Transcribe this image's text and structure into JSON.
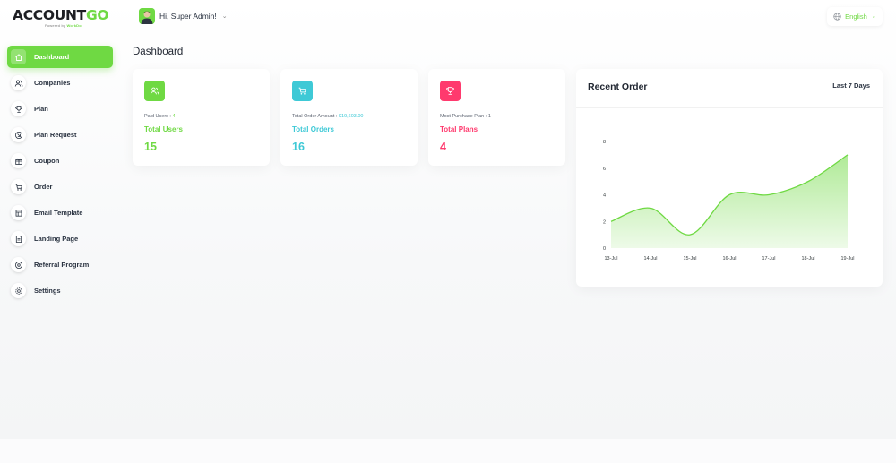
{
  "header": {
    "logo_main": "ACCOUNT",
    "logo_accent": "GO",
    "logo_tagline_prefix": "Powered by",
    "logo_tagline_brand": "WorkDo",
    "greeting": "Hi, Super Admin!",
    "language": "English"
  },
  "sidebar": {
    "items": [
      {
        "label": "Dashboard",
        "icon": "home-icon",
        "active": true
      },
      {
        "label": "Companies",
        "icon": "users-icon",
        "active": false
      },
      {
        "label": "Plan",
        "icon": "trophy-icon",
        "active": false
      },
      {
        "label": "Plan Request",
        "icon": "arrow-circle-icon",
        "active": false
      },
      {
        "label": "Coupon",
        "icon": "gift-icon",
        "active": false
      },
      {
        "label": "Order",
        "icon": "cart-icon",
        "active": false
      },
      {
        "label": "Email Template",
        "icon": "template-icon",
        "active": false
      },
      {
        "label": "Landing Page",
        "icon": "page-icon",
        "active": false
      },
      {
        "label": "Referral Program",
        "icon": "share-icon",
        "active": false
      },
      {
        "label": "Settings",
        "icon": "gear-icon",
        "active": false
      }
    ]
  },
  "page": {
    "title": "Dashboard"
  },
  "stats": [
    {
      "sub_label": "Paid Users : ",
      "sub_value": "4",
      "name": "Total Users",
      "value": "15",
      "color": "#6fd943",
      "icon": "users-icon"
    },
    {
      "sub_label": "Total Order Amount : ",
      "sub_value": "$19,603.00",
      "name": "Total Orders",
      "value": "16",
      "color": "#3ec9d6",
      "icon": "cart-icon"
    },
    {
      "sub_label": "Most Purchase Plan : ",
      "sub_value": "1",
      "name": "Total Plans",
      "value": "4",
      "color": "#ff3a6e",
      "icon": "trophy-icon"
    }
  ],
  "recent_order": {
    "title": "Recent Order",
    "range": "Last 7 Days"
  },
  "chart_data": {
    "type": "area",
    "categories": [
      "13-Jul",
      "14-Jul",
      "15-Jul",
      "16-Jul",
      "17-Jul",
      "18-Jul",
      "19-Jul"
    ],
    "values": [
      2,
      3,
      1,
      4,
      4,
      5,
      7
    ],
    "ylim": [
      0,
      8
    ],
    "yticks": [
      0,
      2,
      4,
      6,
      8
    ],
    "color": "#6fd943",
    "grid": false
  }
}
